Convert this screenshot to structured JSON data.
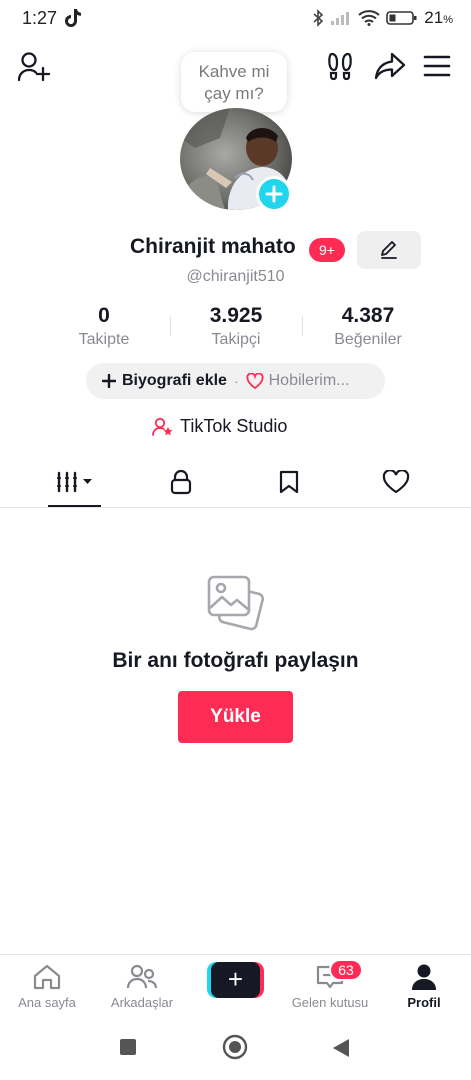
{
  "status_bar": {
    "time": "1:27",
    "battery": "21",
    "battery_unit": "%"
  },
  "profile": {
    "note": {
      "line1": "Kahve mi",
      "line2": "çay mı?"
    },
    "display_name": "Chiranjit mahato",
    "notification_badge": "9+",
    "username": "@chiranjit510"
  },
  "stats": [
    {
      "value": "0",
      "label": "Takipte"
    },
    {
      "value": "3.925",
      "label": "Takipçi"
    },
    {
      "value": "4.387",
      "label": "Beğeniler"
    }
  ],
  "bio": {
    "add_label": "Biyografi ekle",
    "separator": "·",
    "hobby_label": "Hobilerim..."
  },
  "studio": {
    "label": "TikTok Studio"
  },
  "empty_state": {
    "title": "Bir anı fotoğrafı paylaşın",
    "button": "Yükle"
  },
  "bottom_nav": {
    "home": "Ana sayfa",
    "friends": "Arkadaşlar",
    "inbox": "Gelen kutusu",
    "inbox_badge": "63",
    "profile": "Profil"
  },
  "colors": {
    "accent": "#fe2c55",
    "cyan": "#20d5ec",
    "text": "#161823",
    "muted": "#8a8b91"
  }
}
